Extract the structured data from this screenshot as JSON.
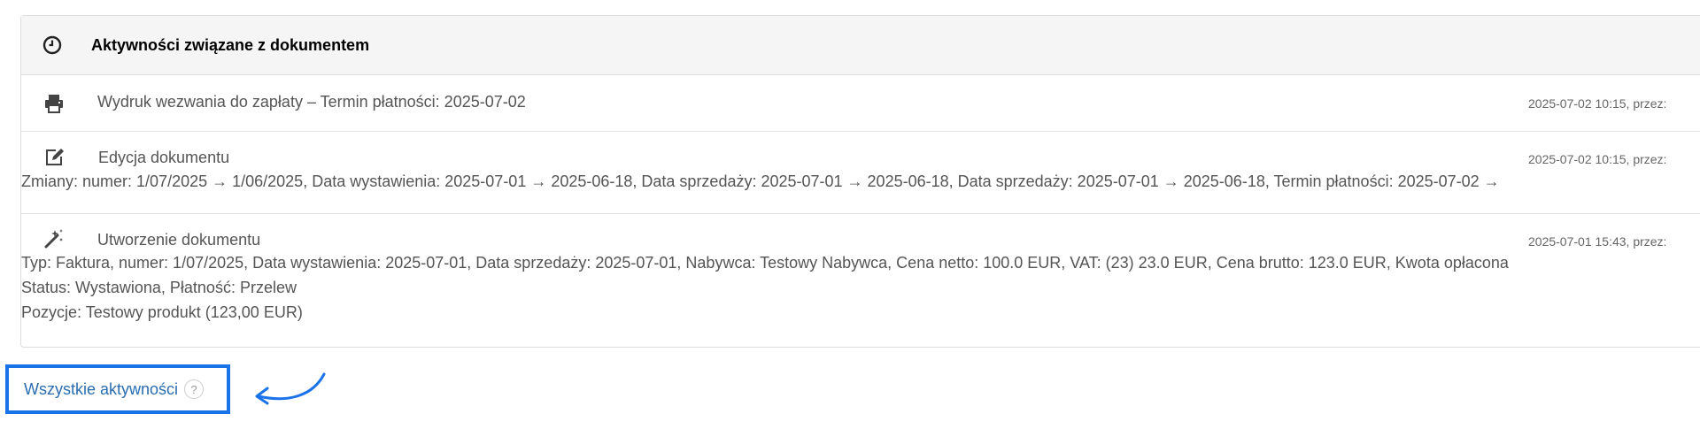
{
  "panel": {
    "title": "Aktywności związane z dokumentem",
    "header_icon": "clock-icon"
  },
  "activities": [
    {
      "icon": "printer-icon",
      "title": "Wydruk wezwania do zapłaty – Termin płatności: 2025-07-02",
      "meta": "2025-07-02 10:15, przez:",
      "lines": []
    },
    {
      "icon": "edit-icon",
      "title": "Edycja dokumentu",
      "meta": "2025-07-02 10:15, przez:",
      "lines": [
        "Zmiany: numer: 1/07/2025 → 1/06/2025, Data wystawienia: 2025-07-01 → 2025-06-18, Data sprzedaży: 2025-07-01 → 2025-06-18, Data sprzedaży: 2025-07-01 → 2025-06-18, Termin płatności: 2025-07-02 →"
      ]
    },
    {
      "icon": "magic-wand-icon",
      "title": "Utworzenie dokumentu",
      "meta": "2025-07-01 15:43, przez:",
      "lines": [
        "Typ: Faktura, numer: 1/07/2025, Data wystawienia: 2025-07-01, Data sprzedaży: 2025-07-01, Nabywca: Testowy Nabywca, Cena netto: 100.0 EUR, VAT: (23) 23.0 EUR, Cena brutto: 123.0 EUR, Kwota opłacona",
        "Status: Wystawiona, Płatność: Przelew",
        "Pozycje: Testowy produkt (123,00 EUR)"
      ]
    }
  ],
  "footer": {
    "all_link": "Wszystkie aktywności",
    "help": "?",
    "accent_color": "#1a73e8"
  }
}
